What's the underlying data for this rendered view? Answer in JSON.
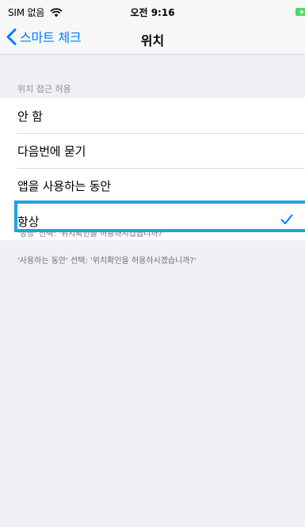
{
  "status_bar": {
    "carrier": "SIM 없음",
    "time": "오전 9:16"
  },
  "navbar": {
    "back_label": "스마트 체크",
    "title": "위치"
  },
  "section": {
    "header": "위치 접근 허용",
    "options": [
      {
        "label": "안 함",
        "selected": false
      },
      {
        "label": "다음번에 묻기",
        "selected": false
      },
      {
        "label": "앱을 사용하는 동안",
        "selected": false
      },
      {
        "label": "항상",
        "selected": true
      }
    ]
  },
  "footer_notes": [
    "'항상' 선택: '위치확인을 허용하시겠습니까?'",
    "'사용하는 동안' 선택: '위치확인을 허용하시겠습니까?'"
  ],
  "colors": {
    "accent": "#007aff",
    "highlight": "#1aa4e0",
    "battery": "#4cd964"
  }
}
